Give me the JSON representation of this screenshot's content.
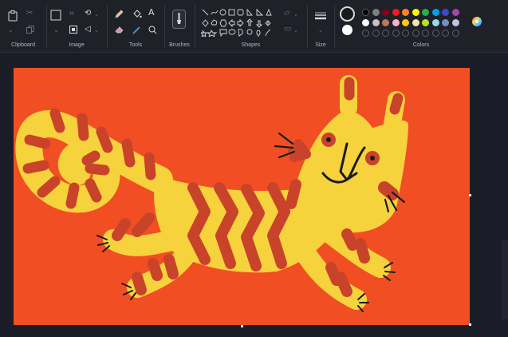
{
  "ribbon": {
    "groups": {
      "clipboard": {
        "label": "Clipboard"
      },
      "image": {
        "label": "Image"
      },
      "tools": {
        "label": "Tools"
      },
      "brushes": {
        "label": "Brushes"
      },
      "shapes": {
        "label": "Shapes"
      },
      "size": {
        "label": "Size"
      },
      "colors": {
        "label": "Colors"
      }
    },
    "tools_text_glyph": "A",
    "icons": {
      "paste": "paste-icon",
      "cut": "scissors-icon",
      "copy": "copy-icon",
      "select": "select-rectangle-icon",
      "crop": "crop-icon",
      "resize": "resize-icon",
      "rotate": "rotate-icon",
      "pencil": "pencil-icon",
      "fill": "fill-bucket-icon",
      "text": "text-icon",
      "eraser": "eraser-icon",
      "picker": "color-picker-icon",
      "magnifier": "magnifier-icon",
      "brush": "brush-icon",
      "size": "line-size-icon",
      "edit_colors": "color-wheel-icon"
    }
  },
  "colors": {
    "primary": "#1a1a1a",
    "secondary": "#ffffff",
    "palette_row1": [
      "#000000",
      "#7f7f7f",
      "#880015",
      "#ed1c24",
      "#ff7f27",
      "#fff200",
      "#22b14c",
      "#00a2e8",
      "#3f48cc",
      "#a349a4"
    ],
    "palette_row2": [
      "#ffffff",
      "#c3c3c3",
      "#b97a57",
      "#ffaec9",
      "#ffc90e",
      "#efe4b0",
      "#b5e61d",
      "#99d9ea",
      "#7092be",
      "#c8bfe7"
    ],
    "palette_row3_empty": 10
  },
  "canvas": {
    "background": "#f24e23",
    "illustration": "tiger-drawing"
  }
}
